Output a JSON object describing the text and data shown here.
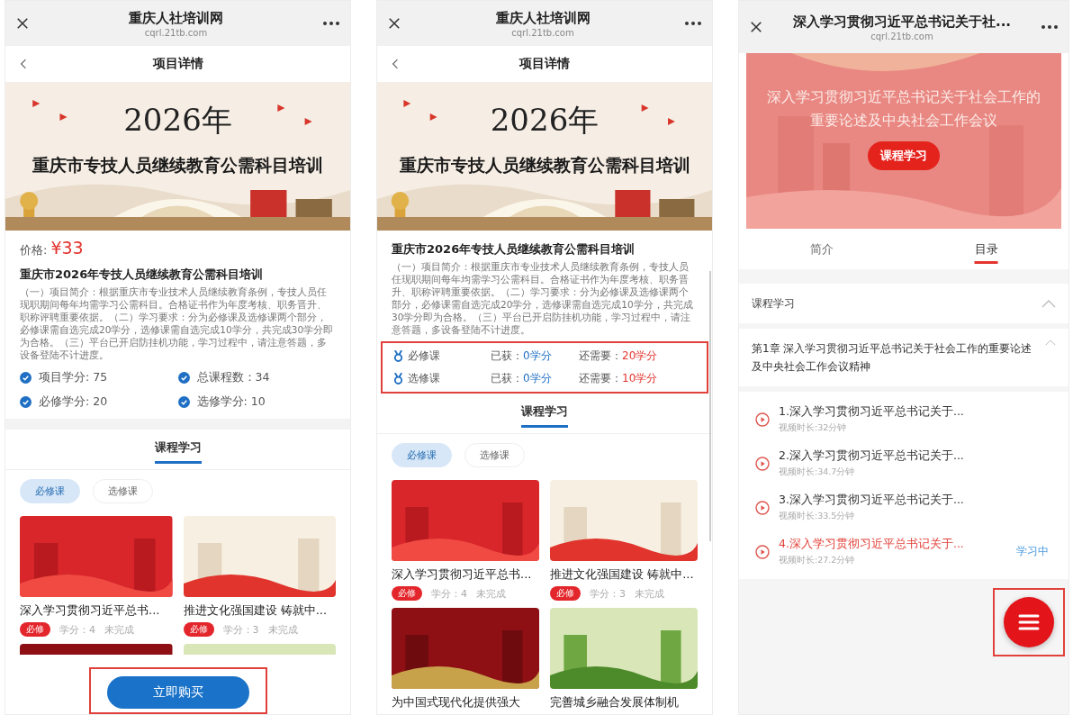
{
  "left_screen": {
    "header": {
      "title": "重庆人社培训网",
      "url": "cqrl.21tb.com"
    },
    "nav_title": "项目详情",
    "banner": {
      "headline": "2026年",
      "subtitle": "重庆市专技人员继续教育公需科目培训"
    },
    "price_label": "价格:",
    "price": "¥33",
    "project_title": "重庆市2026年专技人员继续教育公需科目培训",
    "description": "（一）项目简介：根据重庆市专业技术人员继续教育条例，专技人员任现职期间每年均需学习公需科目。合格证书作为年度考核、职务晋升、职称评聘重要依据。（二）学习要求：分为必修课及选修课两个部分，必修课需自选完成20学分，选修课需自选完成10学分，共完成30学分即为合格。（三）平台已开启防挂机功能，学习过程中，请注意答题，多设备登陆不计进度。",
    "stats": [
      "项目学分: 75",
      "总课程数：34",
      "必修学分: 20",
      "选修学分: 10"
    ],
    "section_tab": "课程学习",
    "filters": [
      {
        "label": "必修课",
        "selected": true
      },
      {
        "label": "选修课",
        "selected": false
      }
    ],
    "courses": [
      {
        "title": "深入学习贯彻习近平总书...",
        "tag": "必修",
        "credit": "学分：4",
        "status": "未完成"
      },
      {
        "title": "推进文化强国建设 铸就中...",
        "tag": "必修",
        "credit": "学分：3",
        "status": "未完成"
      }
    ],
    "buy_button": {
      "label": "立即购买",
      "highlighted": true
    }
  },
  "middle_screen": {
    "header": {
      "title": "重庆人社培训网",
      "url": "cqrl.21tb.com"
    },
    "nav_title": "项目详情",
    "banner": {
      "headline": "2026年",
      "subtitle": "重庆市专技人员继续教育公需科目培训"
    },
    "project_title": "重庆市2026年专技人员继续教育公需科目培训",
    "description": "（一）项目简介：根据重庆市专业技术人员继续教育条例，专技人员任现职期间每年均需学习公需科目。合格证书作为年度考核、职务晋升、职称评聘重要依据。（二）学习要求：分为必修课及选修课两个部分，必修课需自选完成20学分，选修课需自选完成10学分，共完成30学分即为合格。（三）平台已开启防挂机功能，学习过程中，请注意答题，多设备登陆不计进度。",
    "credits_highlighted": true,
    "credits": [
      {
        "name": "必修课",
        "earned_label": "已获：",
        "earned": "0学分",
        "need_label": "还需要：",
        "need": "20学分"
      },
      {
        "name": "选修课",
        "earned_label": "已获：",
        "earned": "0学分",
        "need_label": "还需要：",
        "need": "10学分"
      }
    ],
    "section_tab": "课程学习",
    "filters": [
      {
        "label": "必修课",
        "selected": true
      },
      {
        "label": "选修课",
        "selected": false
      }
    ],
    "courses": [
      {
        "title": "深入学习贯彻习近平总书...",
        "tag": "必修",
        "credit": "学分：4",
        "status": "未完成"
      },
      {
        "title": "推进文化强国建设 铸就中...",
        "tag": "必修",
        "credit": "学分：3",
        "status": "未完成"
      },
      {
        "title": "为中国式现代化提供强大"
      },
      {
        "title": "完善城乡融合发展体制机"
      }
    ]
  },
  "right_screen": {
    "header": {
      "title": "深入学习贯彻习近平总书记关于社...",
      "url": "cqrl.21tb.com"
    },
    "cover": {
      "title": "深入学习贯彻习近平总书记关于社会工作的重要论述及中央社会工作会议",
      "button": "课程学习"
    },
    "tabs": [
      {
        "label": "简介",
        "selected": false
      },
      {
        "label": "目录",
        "selected": true
      }
    ],
    "section": {
      "title": "课程学习",
      "expanded": true
    },
    "chapter": {
      "title": "第1章 深入学习贯彻习近平总书记关于社会工作的重要论述及中央社会工作会议精神",
      "expanded": true
    },
    "lessons": [
      {
        "title": "1.深入学习贯彻习近平总书记关于...",
        "duration": "视频时长:32分钟",
        "current": false
      },
      {
        "title": "2.深入学习贯彻习近平总书记关于...",
        "duration": "视频时长:34.7分钟",
        "current": false
      },
      {
        "title": "3.深入学习贯彻习近平总书记关于...",
        "duration": "视频时长:33.5分钟",
        "current": false
      },
      {
        "title": "4.深入学习贯彻习近平总书记关于...",
        "duration": "视频时长:27.2分钟",
        "current": true,
        "status": "学习中"
      }
    ],
    "menu_button": {
      "highlighted": true
    }
  }
}
